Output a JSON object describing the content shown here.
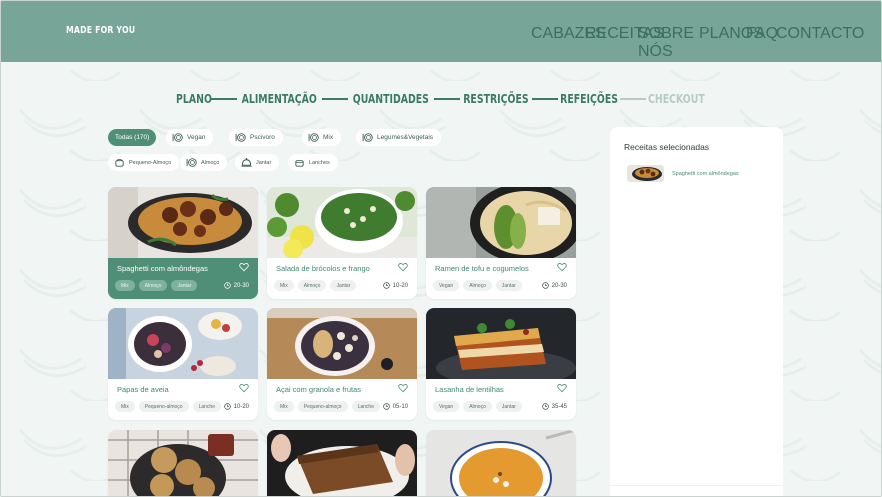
{
  "brand": "MADE FOR YOU",
  "nav": [
    "CABAZES",
    "RECEITAS",
    "SOBRE NÓS",
    "PLANOS",
    "FAQ",
    "CONTACTO"
  ],
  "steps": [
    {
      "label": "PLANO",
      "active": true
    },
    {
      "label": "ALIMENTAÇÃO",
      "active": true
    },
    {
      "label": "QUANTIDADES",
      "active": true
    },
    {
      "label": "RESTRIÇÕES",
      "active": true
    },
    {
      "label": "REFEIÇÕES",
      "active": true
    },
    {
      "label": "CHECKOUT",
      "active": false
    }
  ],
  "diet_filters": [
    {
      "label": "Todas (170)",
      "icon": "none",
      "selected": true
    },
    {
      "label": "Vegan",
      "icon": "plate-icon",
      "selected": false
    },
    {
      "label": "Pscivoro",
      "icon": "plate-icon",
      "selected": false
    },
    {
      "label": "Mix",
      "icon": "plate-icon",
      "selected": false
    },
    {
      "label": "Legumes&Vegetais",
      "icon": "plate-icon",
      "selected": false
    }
  ],
  "meal_filters": [
    {
      "label": "Pequeno-Almoço",
      "icon": "breakfast-icon"
    },
    {
      "label": "Almoço",
      "icon": "plate-icon"
    },
    {
      "label": "Jantar",
      "icon": "cloche-icon"
    },
    {
      "label": "Lanches",
      "icon": "snack-icon"
    }
  ],
  "recipes": [
    {
      "title": "Spaghetti com almôndegas",
      "tags": [
        "Mix",
        "Almoço",
        "Jantar"
      ],
      "time": "20-30",
      "selected": true,
      "image": "spaghetti-photo"
    },
    {
      "title": "Salada de brócolos e frango",
      "tags": [
        "Mix",
        "Almoço",
        "Jantar"
      ],
      "time": "10-20",
      "selected": false,
      "image": "salad-photo"
    },
    {
      "title": "Ramen de tofu e cogumelos",
      "tags": [
        "Vegan",
        "Almoço",
        "Jantar"
      ],
      "time": "20-30",
      "selected": false,
      "image": "ramen-photo"
    },
    {
      "title": "Papas de aveia",
      "tags": [
        "Mix",
        "Pequeno-almoço",
        "Lanche"
      ],
      "time": "10-20",
      "selected": false,
      "image": "oatmeal-photo"
    },
    {
      "title": "Açai com granola e frutas",
      "tags": [
        "Mix",
        "Pequeno-almoço",
        "Lanche"
      ],
      "time": "05-10",
      "selected": false,
      "image": "acai-photo"
    },
    {
      "title": "Lasanha de lentilhas",
      "tags": [
        "Vegan",
        "Almoço",
        "Jantar"
      ],
      "time": "35-45",
      "selected": false,
      "image": "lasagna-photo"
    }
  ],
  "partial_recipes": [
    {
      "image": "cookies-photo"
    },
    {
      "image": "banana-bread-photo"
    },
    {
      "image": "soup-photo"
    }
  ],
  "panel": {
    "title": "Receitas selecionadas",
    "items": [
      {
        "label": "Spaghetti com almôndegas",
        "image": "spaghetti-photo"
      }
    ]
  },
  "colors": {
    "header": "#77a597",
    "accent": "#4f8f77",
    "background": "#f1f6f4",
    "inactive": "#b6cbc4"
  }
}
